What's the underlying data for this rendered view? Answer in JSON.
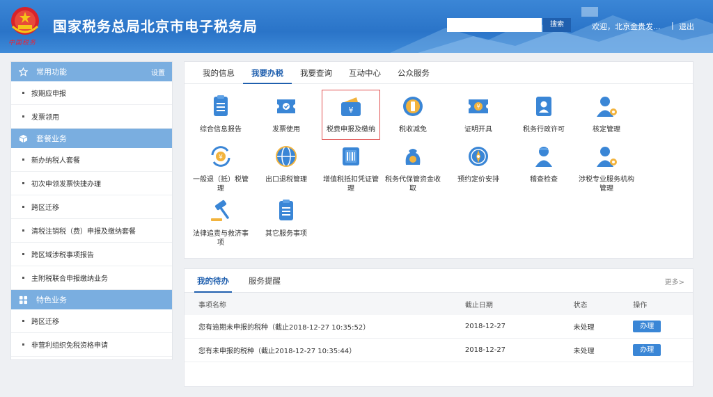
{
  "header": {
    "site_title": "国家税务总局北京市电子税务局",
    "emblem_sub": "中国税务",
    "search_placeholder": "",
    "search_button": "搜索",
    "welcome": "欢迎，北京金贵发...",
    "separator": "|",
    "logout": "退出"
  },
  "sidebar": {
    "sections": [
      {
        "title": "常用功能",
        "icon": "star-icon",
        "right": "设置",
        "items": [
          "按期应申报",
          "发票领用"
        ]
      },
      {
        "title": "套餐业务",
        "icon": "cube-icon",
        "right": "",
        "items": [
          "新办纳税人套餐",
          "初次申领发票快捷办理",
          "跨区迁移",
          "清税注销税（费）申报及缴纳套餐",
          "跨区域涉税事项报告",
          "主附税联合申报缴纳业务"
        ]
      },
      {
        "title": "特色业务",
        "icon": "grid-icon",
        "right": "",
        "items": [
          "跨区迁移",
          "非营利组织免税资格申请"
        ]
      }
    ]
  },
  "main": {
    "tabs": [
      "我的信息",
      "我要办税",
      "我要查询",
      "互动中心",
      "公众服务"
    ],
    "active_tab": 1,
    "tiles": [
      {
        "label": "综合信息报告",
        "icon": "report-icon"
      },
      {
        "label": "发票使用",
        "icon": "invoice-icon"
      },
      {
        "label": "税费申报及缴纳",
        "icon": "wallet-yuan-icon"
      },
      {
        "label": "税收减免",
        "icon": "coin-reduce-icon"
      },
      {
        "label": "证明开具",
        "icon": "certificate-icon"
      },
      {
        "label": "税务行政许可",
        "icon": "id-card-icon"
      },
      {
        "label": "核定管理",
        "icon": "user-gear-icon"
      },
      {
        "label": "一般退（抵）税管理",
        "icon": "refund-icon"
      },
      {
        "label": "出口退税管理",
        "icon": "globe-icon"
      },
      {
        "label": "增值税抵扣凭证管理",
        "icon": "voucher-icon"
      },
      {
        "label": "税务代保管资金收取",
        "icon": "money-bag-icon"
      },
      {
        "label": "预约定价安排",
        "icon": "compass-icon"
      },
      {
        "label": "稽查检查",
        "icon": "inspector-icon"
      },
      {
        "label": "涉税专业服务机构管理",
        "icon": "agency-gear-icon"
      },
      {
        "label": "法律追责与救济事项",
        "icon": "gavel-icon"
      },
      {
        "label": "其它服务事项",
        "icon": "list-icon"
      }
    ]
  },
  "todo": {
    "tabs": [
      "我的待办",
      "服务提醒"
    ],
    "more": "更多>",
    "columns": [
      "事项名称",
      "截止日期",
      "状态",
      "操作"
    ],
    "rows": [
      {
        "name": "您有逾期未申报的税种（截止2018-12-27 10:35:52）",
        "date": "2018-12-27",
        "status": "未处理",
        "action": "办理"
      },
      {
        "name": "您有未申报的税种（截止2018-12-27 10:35:44）",
        "date": "2018-12-27",
        "status": "未处理",
        "action": "办理"
      }
    ]
  },
  "colors": {
    "header": "#2a74c8",
    "accent": "#1f5fae",
    "sidebar_head": "#7aaee0",
    "selected_border": "#e05050"
  }
}
